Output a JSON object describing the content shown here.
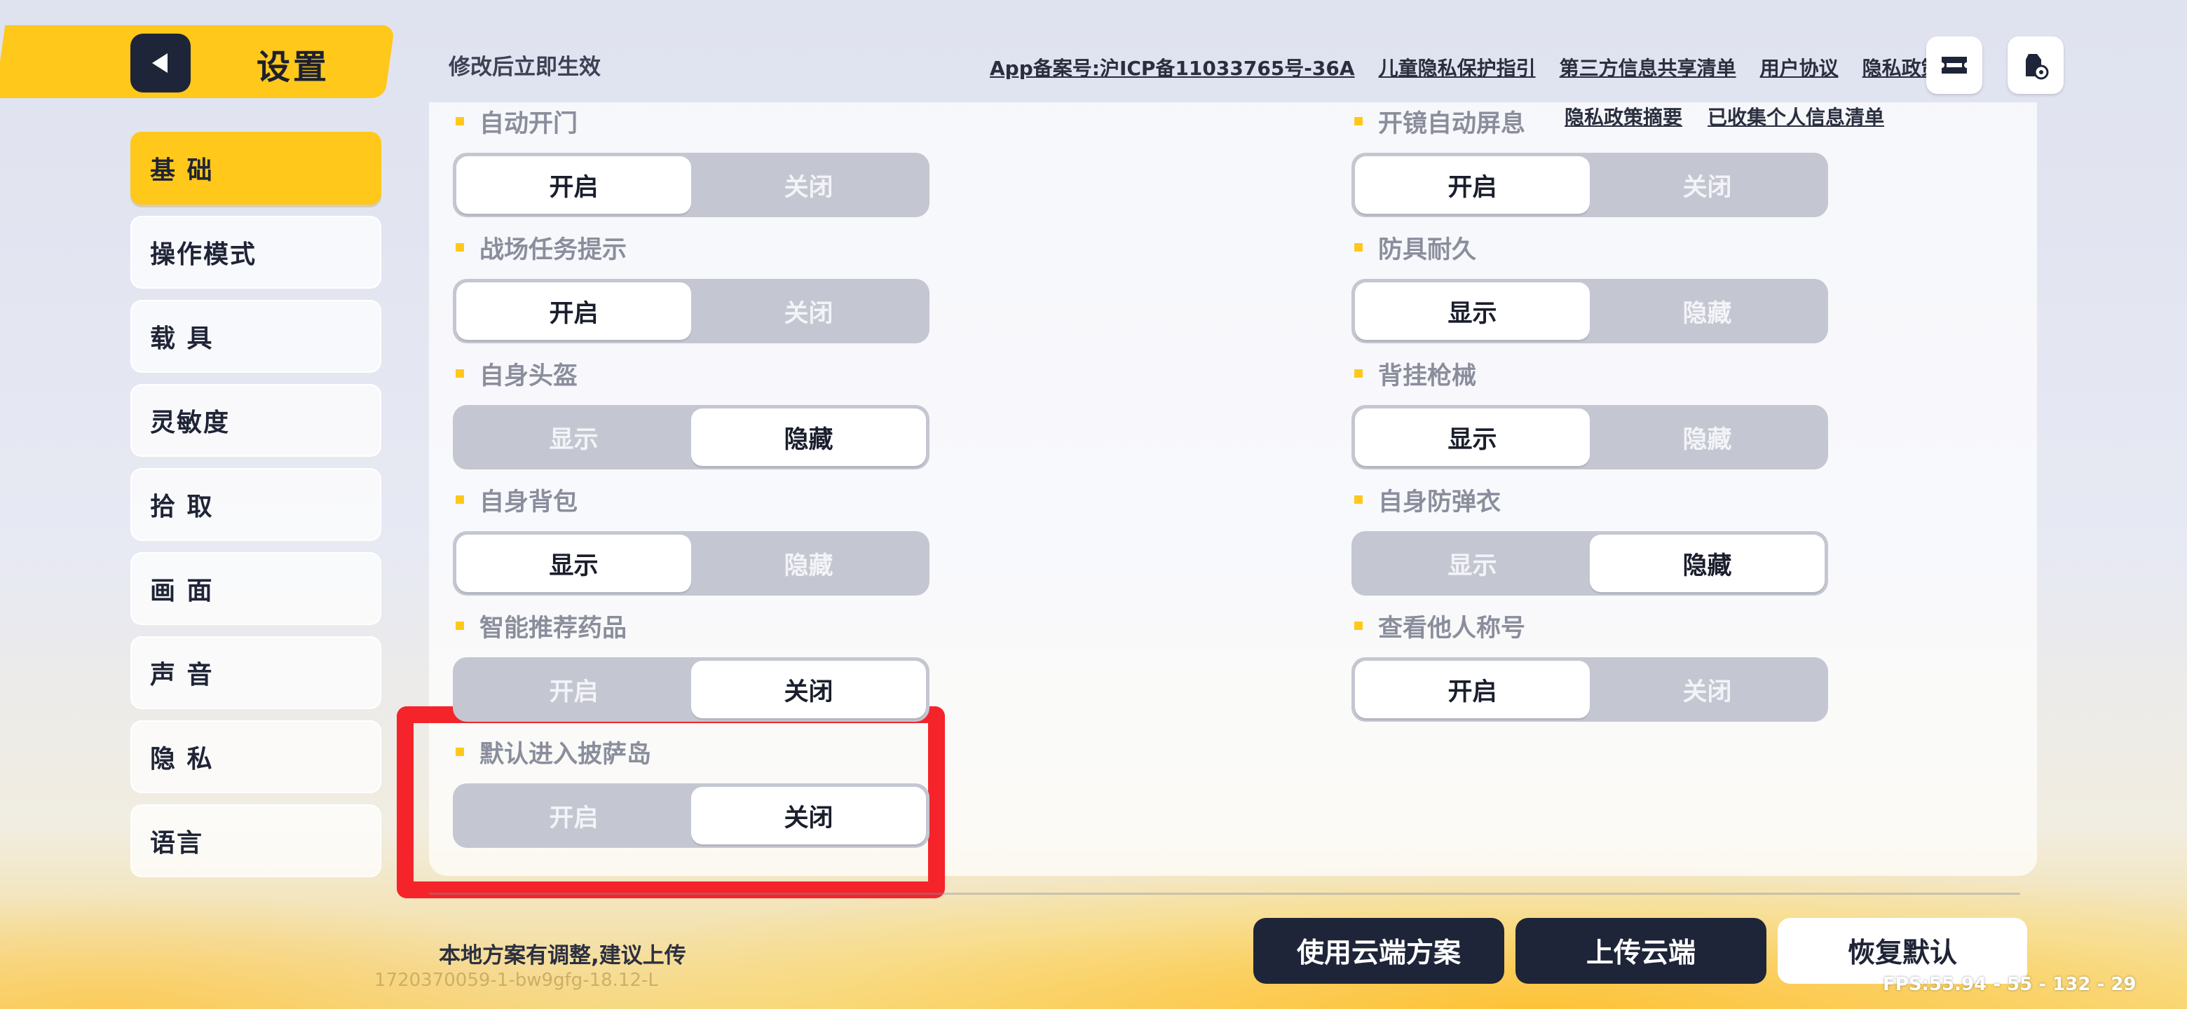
{
  "header": {
    "title": "设置",
    "hint": "修改后立即生效",
    "links": [
      "App备案号:沪ICP备11033765号-36A",
      "儿童隐私保护指引",
      "第三方信息共享清单",
      "用户协议",
      "隐私政策"
    ],
    "icons": [
      "ticket-icon",
      "service-gear-icon"
    ]
  },
  "sidebar": {
    "items": [
      {
        "label": "基 础",
        "active": true
      },
      {
        "label": "操作模式",
        "active": false
      },
      {
        "label": "载 具",
        "active": false
      },
      {
        "label": "灵敏度",
        "active": false
      },
      {
        "label": "拾 取",
        "active": false
      },
      {
        "label": "画 面",
        "active": false
      },
      {
        "label": "声 音",
        "active": false
      },
      {
        "label": "隐 私",
        "active": false
      },
      {
        "label": "语言",
        "active": false
      }
    ]
  },
  "panel": {
    "links": [
      "隐私政策摘要",
      "已收集个人信息清单"
    ],
    "left": [
      {
        "label": "自动开门",
        "options": [
          "开启",
          "关闭"
        ],
        "selected": 0
      },
      {
        "label": "战场任务提示",
        "options": [
          "开启",
          "关闭"
        ],
        "selected": 0
      },
      {
        "label": "自身头盔",
        "options": [
          "显示",
          "隐藏"
        ],
        "selected": 1
      },
      {
        "label": "自身背包",
        "options": [
          "显示",
          "隐藏"
        ],
        "selected": 0
      },
      {
        "label": "智能推荐药品",
        "options": [
          "开启",
          "关闭"
        ],
        "selected": 1
      },
      {
        "label": "默认进入披萨岛",
        "options": [
          "开启",
          "关闭"
        ],
        "selected": 1
      }
    ],
    "right": [
      {
        "label": "开镜自动屏息",
        "options": [
          "开启",
          "关闭"
        ],
        "selected": 0
      },
      {
        "label": "防具耐久",
        "options": [
          "显示",
          "隐藏"
        ],
        "selected": 0
      },
      {
        "label": "背挂枪械",
        "options": [
          "显示",
          "隐藏"
        ],
        "selected": 0
      },
      {
        "label": "自身防弹衣",
        "options": [
          "显示",
          "隐藏"
        ],
        "selected": 1
      },
      {
        "label": "查看他人称号",
        "options": [
          "开启",
          "关闭"
        ],
        "selected": 0
      }
    ]
  },
  "footer": {
    "hint": "本地方案有调整,建议上传",
    "build_id": "1720370059-1-bw9gfg-18.12-L",
    "use_cloud": "使用云端方案",
    "upload_cloud": "上传云端",
    "restore_default": "恢复默认",
    "fps": "FPS:55.94 - 55 - 132 - 29"
  },
  "colors": {
    "accent": "#ffc81a",
    "dark": "#1f2538",
    "highlight": "#f5242b"
  }
}
